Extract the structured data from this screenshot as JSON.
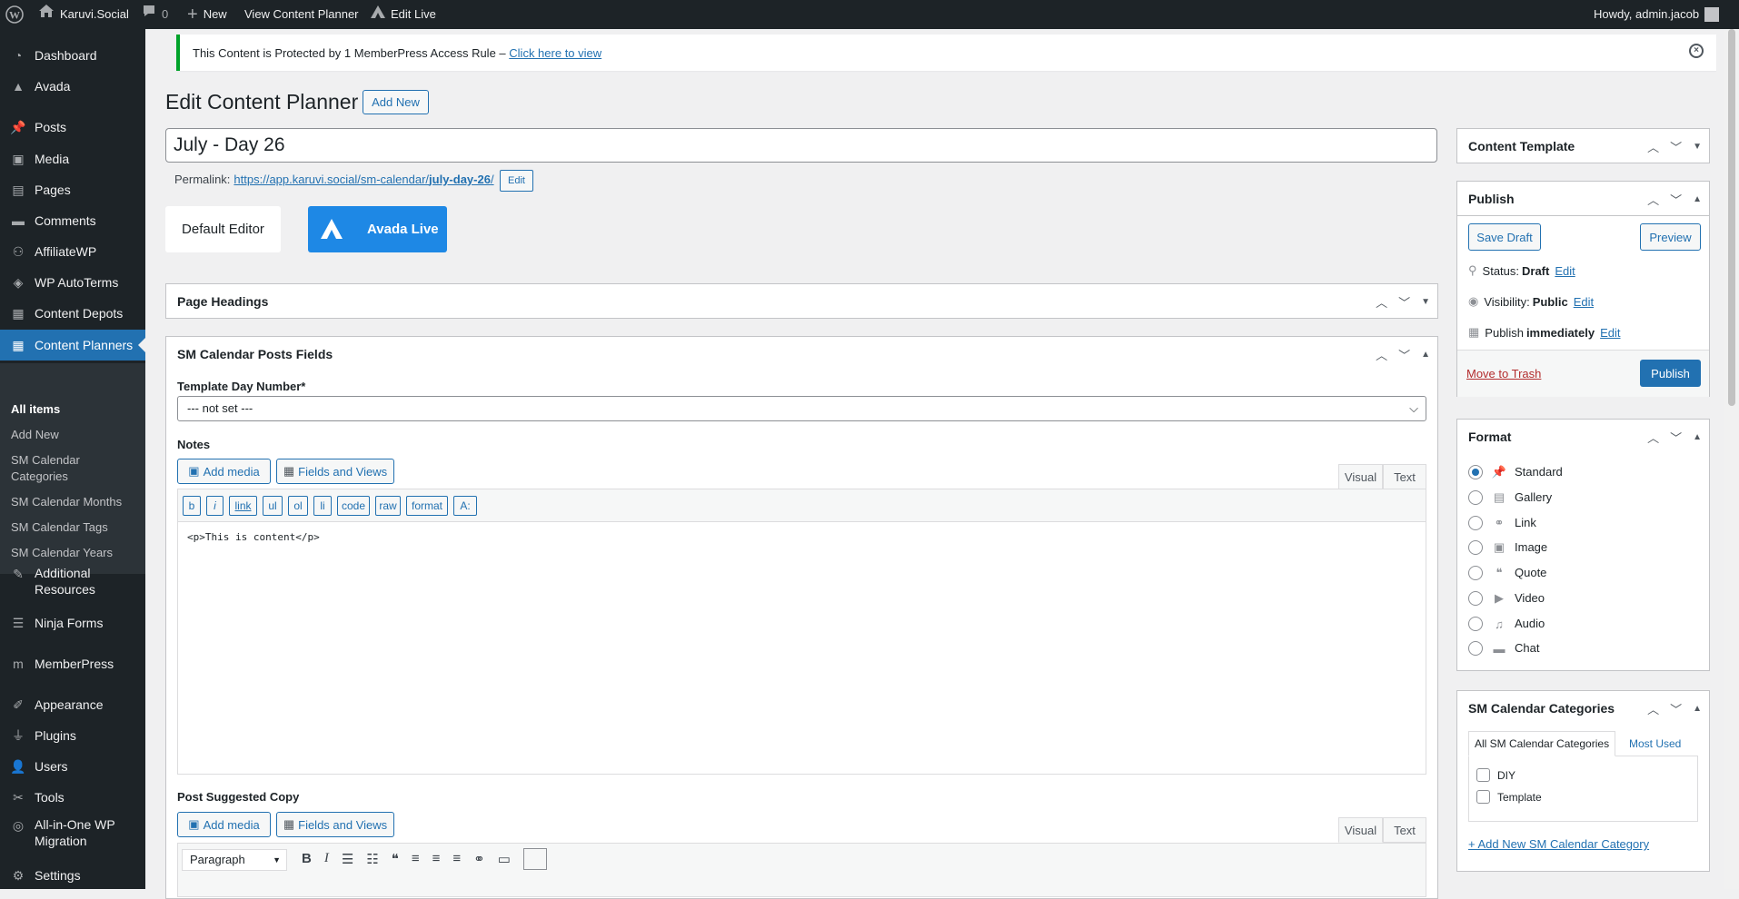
{
  "adminbar": {
    "site_name": "Karuvi.Social",
    "comments_count": "0",
    "new_label": "New",
    "view_label": "View Content Planner",
    "edit_live_label": "Edit Live",
    "howdy": "Howdy, admin.jacob"
  },
  "sidebar": {
    "items": [
      {
        "label": "Dashboard",
        "icon": "dashboard-icon"
      },
      {
        "label": "Avada",
        "icon": "avada-icon"
      },
      {
        "label": "Posts",
        "icon": "pin-icon"
      },
      {
        "label": "Media",
        "icon": "media-icon"
      },
      {
        "label": "Pages",
        "icon": "pages-icon"
      },
      {
        "label": "Comments",
        "icon": "comment-icon"
      },
      {
        "label": "AffiliateWP",
        "icon": "affiliate-icon"
      },
      {
        "label": "WP AutoTerms",
        "icon": "autoterms-icon"
      },
      {
        "label": "Content Depots",
        "icon": "depot-icon"
      },
      {
        "label": "Content Planners",
        "icon": "calendar-icon"
      },
      {
        "label": "Additional Resources",
        "icon": "wrench-icon"
      },
      {
        "label": "Ninja Forms",
        "icon": "forms-icon"
      },
      {
        "label": "MemberPress",
        "icon": "memberpress-icon"
      },
      {
        "label": "Appearance",
        "icon": "brush-icon"
      },
      {
        "label": "Plugins",
        "icon": "plugin-icon"
      },
      {
        "label": "Users",
        "icon": "users-icon"
      },
      {
        "label": "Tools",
        "icon": "tools-icon"
      },
      {
        "label": "All-in-One WP Migration",
        "icon": "migration-icon"
      },
      {
        "label": "Settings",
        "icon": "settings-icon"
      }
    ],
    "submenu": [
      "All items",
      "Add New",
      "SM Calendar Categories",
      "SM Calendar Months",
      "SM Calendar Tags",
      "SM Calendar Years"
    ]
  },
  "notice": {
    "text": "This Content is Protected by 1 MemberPress Access Rule –",
    "link": "Click here to view"
  },
  "page": {
    "title": "Edit Content Planner",
    "add_new": "Add New",
    "post_title": "July - Day 26",
    "permalink_label": "Permalink:",
    "permalink_base": "https://app.karuvi.social/sm-calendar/",
    "permalink_slug": "july-day-26",
    "permalink_end": "/",
    "permalink_edit": "Edit",
    "default_editor": "Default Editor",
    "avada_live": "Avada Live"
  },
  "page_headings": {
    "title": "Page Headings"
  },
  "fields_box": {
    "title": "SM Calendar Posts Fields",
    "template_day_label": "Template Day Number*",
    "template_day_value": "--- not set ---",
    "notes_label": "Notes",
    "add_media": "Add media",
    "fields_views": "Fields and Views",
    "visual_tab": "Visual",
    "text_tab": "Text",
    "quicktags": [
      "b",
      "i",
      "link",
      "ul",
      "ol",
      "li",
      "code",
      "raw",
      "format",
      "A:"
    ],
    "notes_content": "<p>This is content</p>",
    "suggested_label": "Post Suggested Copy",
    "paragraph_select": "Paragraph"
  },
  "sidebar_boxes": {
    "content_template": "Content Template",
    "publish": {
      "title": "Publish",
      "save_draft": "Save Draft",
      "preview": "Preview",
      "status_label": "Status:",
      "status_value": "Draft",
      "visibility_label": "Visibility:",
      "visibility_value": "Public",
      "publish_label": "Publish",
      "publish_value": "immediately",
      "edit": "Edit",
      "trash": "Move to Trash",
      "publish_btn": "Publish"
    },
    "format": {
      "title": "Format",
      "options": [
        {
          "label": "Standard",
          "icon": "pin-icon",
          "selected": true
        },
        {
          "label": "Gallery",
          "icon": "gallery-icon",
          "selected": false
        },
        {
          "label": "Link",
          "icon": "link-icon",
          "selected": false
        },
        {
          "label": "Image",
          "icon": "image-icon",
          "selected": false
        },
        {
          "label": "Quote",
          "icon": "quote-icon",
          "selected": false
        },
        {
          "label": "Video",
          "icon": "video-icon",
          "selected": false
        },
        {
          "label": "Audio",
          "icon": "audio-icon",
          "selected": false
        },
        {
          "label": "Chat",
          "icon": "chat-icon",
          "selected": false
        }
      ]
    },
    "categories": {
      "title": "SM Calendar Categories",
      "tab_all": "All SM Calendar Categories",
      "tab_most": "Most Used",
      "items": [
        "DIY",
        "Template"
      ],
      "add_new": "+ Add New SM Calendar Category"
    }
  },
  "colors": {
    "accent": "#2271b1",
    "adminbar": "#1d2327",
    "notice_green": "#00a32a",
    "trash": "#b32d2e"
  }
}
